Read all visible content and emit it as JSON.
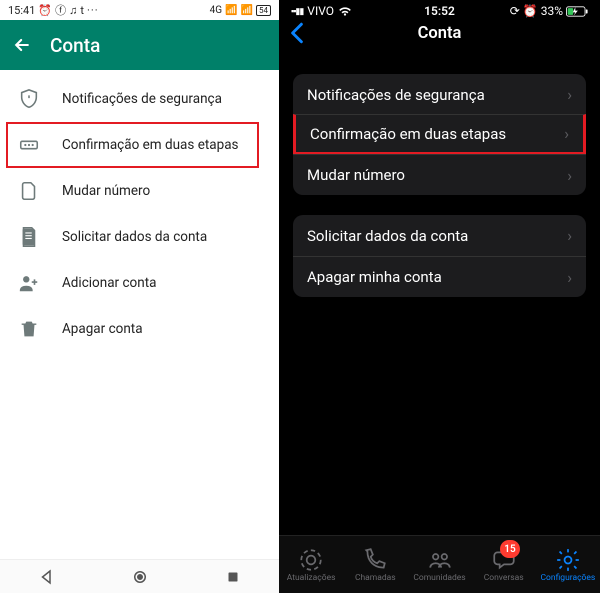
{
  "android": {
    "status": {
      "time": "15:41",
      "net": "4G",
      "batt": "54"
    },
    "title": "Conta",
    "items": [
      {
        "label": "Notificações de segurança"
      },
      {
        "label": "Confirmação em duas etapas",
        "hl": true
      },
      {
        "label": "Mudar número"
      },
      {
        "label": "Solicitar dados da conta"
      },
      {
        "label": "Adicionar conta"
      },
      {
        "label": "Apagar conta"
      }
    ]
  },
  "ios": {
    "status": {
      "carrier": "VIVO",
      "time": "15:52",
      "batt": "33%"
    },
    "title": "Conta",
    "section1": [
      {
        "label": "Notificações de segurança"
      },
      {
        "label": "Confirmação em duas etapas",
        "hl": true
      },
      {
        "label": "Mudar número"
      }
    ],
    "section2": [
      {
        "label": "Solicitar dados da conta"
      },
      {
        "label": "Apagar minha conta"
      }
    ],
    "tabs": [
      {
        "label": "Atualizações"
      },
      {
        "label": "Chamadas"
      },
      {
        "label": "Comunidades"
      },
      {
        "label": "Conversas",
        "badge": "15"
      },
      {
        "label": "Configurações",
        "active": true
      }
    ]
  }
}
